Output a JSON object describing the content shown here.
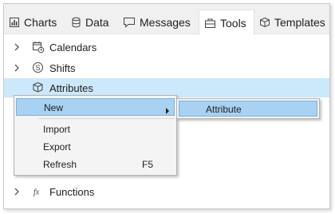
{
  "tabs": [
    {
      "label": "Charts",
      "icon": "bar-chart-icon"
    },
    {
      "label": "Data",
      "icon": "database-icon"
    },
    {
      "label": "Messages",
      "icon": "chat-bubble-icon"
    },
    {
      "label": "Tools",
      "icon": "toolbox-icon",
      "active": true
    },
    {
      "label": "Templates",
      "icon": "cube-icon"
    }
  ],
  "tree": {
    "items": [
      {
        "label": "Calendars",
        "icon": "calendar-clock-icon"
      },
      {
        "label": "Shifts",
        "icon": "circled-s-icon"
      },
      {
        "label": "Attributes",
        "icon": "cube-icon",
        "selected": true
      },
      {
        "label": "Functions",
        "icon": "fx-icon"
      }
    ]
  },
  "context_menu": {
    "items": [
      {
        "label": "New",
        "has_submenu": true
      },
      {
        "label": "Import"
      },
      {
        "label": "Export"
      },
      {
        "label": "Refresh",
        "shortcut": "F5"
      }
    ]
  },
  "submenu": {
    "items": [
      {
        "label": "Attribute"
      }
    ]
  },
  "colors": {
    "selected_row": "#cce8fb",
    "menu_highlight": "#a8d1f2",
    "menu_highlight_border": "#7bb3e0",
    "tabbar_bg": "#f0f0f0"
  }
}
